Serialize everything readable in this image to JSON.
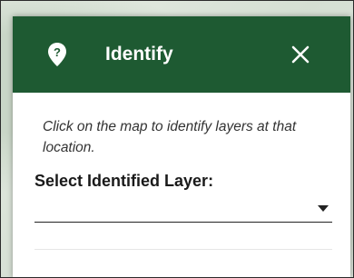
{
  "panel": {
    "title": "Identify",
    "header_color": "#1e5a32",
    "icons": {
      "header": "map-pin-question-icon",
      "close": "close-icon",
      "dropdown": "caret-down-icon"
    }
  },
  "instructions": "Click on the map to identify layers at that location.",
  "layer_select": {
    "label": "Select Identified Layer:",
    "value": ""
  }
}
